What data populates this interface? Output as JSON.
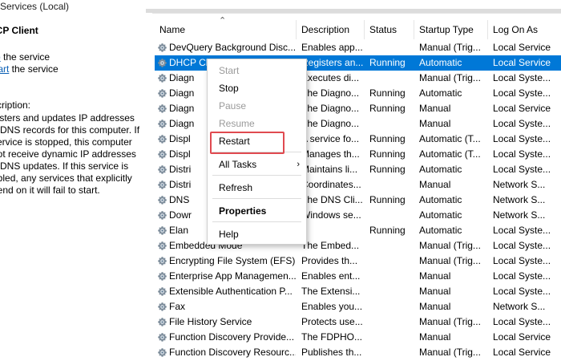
{
  "window": {
    "title": "Services (Local)"
  },
  "left_pane": {
    "service_title": "HCP Client",
    "stop_link": "p",
    "stop_rest": " the service",
    "restart_link": "tart",
    "restart_rest": " the service",
    "description_label": "scription:",
    "description_text": "gisters and updates IP addresses\nd DNS records for this computer. If\nservice is stopped, this computer\nnot receive dynamic IP addresses\nd DNS updates. If this service is\nabled, any services that explicitly\npend on it will fail to start."
  },
  "columns": [
    "Name",
    "Description",
    "Status",
    "Startup Type",
    "Log On As"
  ],
  "services": [
    {
      "name": "DevQuery Background Disc...",
      "desc": "Enables app...",
      "status": "",
      "startup": "Manual (Trig...",
      "logon": "Local Service"
    },
    {
      "name": "DHCP Cli",
      "desc": "Registers an...",
      "status": "Running",
      "startup": "Automatic",
      "logon": "Local Service",
      "selected": true
    },
    {
      "name": "Diagn",
      "desc": "Executes di...",
      "status": "",
      "startup": "Manual (Trig...",
      "logon": "Local Syste..."
    },
    {
      "name": "Diagn",
      "desc": "The Diagno...",
      "status": "Running",
      "startup": "Automatic",
      "logon": "Local Syste..."
    },
    {
      "name": "Diagn",
      "desc": "The Diagno...",
      "status": "Running",
      "startup": "Manual",
      "logon": "Local Service"
    },
    {
      "name": "Diagn",
      "desc": "The Diagno...",
      "status": "",
      "startup": "Manual",
      "logon": "Local Syste..."
    },
    {
      "name": "Displ",
      "desc": "A service fo...",
      "status": "Running",
      "startup": "Automatic (T...",
      "logon": "Local Syste..."
    },
    {
      "name": "Displ",
      "desc": "Manages th...",
      "status": "Running",
      "startup": "Automatic (T...",
      "logon": "Local Syste..."
    },
    {
      "name": "Distri",
      "desc": "Maintains li...",
      "status": "Running",
      "startup": "Automatic",
      "logon": "Local Syste..."
    },
    {
      "name": "Distri",
      "desc": "Coordinates...",
      "status": "",
      "startup": "Manual",
      "logon": "Network S..."
    },
    {
      "name": "DNS",
      "desc": "The DNS Cli...",
      "status": "Running",
      "startup": "Automatic",
      "logon": "Network S..."
    },
    {
      "name": "Dowr",
      "desc": "Windows se...",
      "status": "",
      "startup": "Automatic",
      "logon": "Network S..."
    },
    {
      "name": "Elan",
      "desc": "",
      "status": "Running",
      "startup": "Automatic",
      "logon": "Local Syste..."
    },
    {
      "name": "Embedded Mode",
      "desc": "The Embed...",
      "status": "",
      "startup": "Manual (Trig...",
      "logon": "Local Syste..."
    },
    {
      "name": "Encrypting File System (EFS)",
      "desc": "Provides th...",
      "status": "",
      "startup": "Manual (Trig...",
      "logon": "Local Syste..."
    },
    {
      "name": "Enterprise App Managemen...",
      "desc": "Enables ent...",
      "status": "",
      "startup": "Manual",
      "logon": "Local Syste..."
    },
    {
      "name": "Extensible Authentication P...",
      "desc": "The Extensi...",
      "status": "",
      "startup": "Manual",
      "logon": "Local Syste..."
    },
    {
      "name": "Fax",
      "desc": "Enables you...",
      "status": "",
      "startup": "Manual",
      "logon": "Network S..."
    },
    {
      "name": "File History Service",
      "desc": "Protects use...",
      "status": "",
      "startup": "Manual (Trig...",
      "logon": "Local Syste..."
    },
    {
      "name": "Function Discovery Provide...",
      "desc": "The FDPHO...",
      "status": "",
      "startup": "Manual",
      "logon": "Local Service"
    },
    {
      "name": "Function Discovery Resourc...",
      "desc": "Publishes th...",
      "status": "",
      "startup": "Manual (Trig...",
      "logon": "Local Service"
    }
  ],
  "context_menu": {
    "items": [
      {
        "label": "Start",
        "state": "disabled"
      },
      {
        "label": "Stop",
        "state": "enabled"
      },
      {
        "label": "Pause",
        "state": "disabled"
      },
      {
        "label": "Resume",
        "state": "disabled"
      },
      {
        "label": "Restart",
        "state": "enabled",
        "highlighted": true
      },
      {
        "label": "All Tasks",
        "state": "enabled",
        "submenu": true
      },
      {
        "label": "Refresh",
        "state": "enabled"
      },
      {
        "label": "Properties",
        "state": "enabled",
        "bold": true
      },
      {
        "label": "Help",
        "state": "enabled"
      }
    ],
    "submenu_glyph": "›"
  },
  "colors": {
    "selection": "#0078d7",
    "link": "#0a5fb4",
    "highlight_border": "#e04a50"
  },
  "icons": {
    "service_icon": "gear-icon",
    "sort": "sort-ascending-icon"
  }
}
